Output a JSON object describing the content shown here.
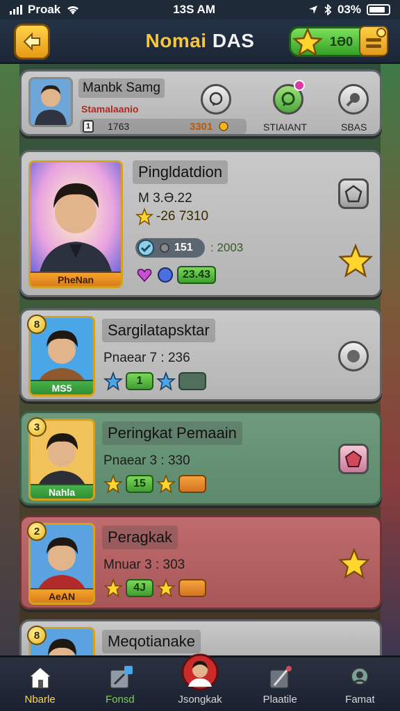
{
  "status_bar": {
    "carrier": "Proak",
    "time": "13S AM",
    "battery": "03%"
  },
  "header": {
    "title_part1": "Nomai",
    "title_part2": "DAS",
    "coins": "1Ə0"
  },
  "profile": {
    "name": "Manbk Samg",
    "subtitle": "Stamalaanio",
    "level_badge": "1",
    "score": "1763",
    "coins": "3301",
    "actions": [
      {
        "label": ""
      },
      {
        "label": "STIAIANT"
      },
      {
        "label": "SBAS"
      }
    ]
  },
  "featured": {
    "name": "Pingldatdion",
    "portrait_label": "PheNan",
    "line1": "M 3.Ə.22",
    "line2": "-26 7310",
    "stat_a": "151",
    "stat_b": ": 2003",
    "stat_c": "23.43"
  },
  "players": [
    {
      "rank": "8",
      "name": "Sargilatapsktar",
      "portrait_label": "MS5",
      "stat": "Pnaear 7 : 236",
      "bar_value": "1",
      "bar_color": "green",
      "theme": "grey"
    },
    {
      "rank": "3",
      "name": "Peringkat Pemaain",
      "portrait_label": "Nahla",
      "stat": "Pnaear 3 : 330",
      "bar_value": "15",
      "bar_color": "green",
      "theme": "green"
    },
    {
      "rank": "2",
      "name": "Peragkak",
      "portrait_label": "AeAN",
      "stat": "Mnuar 3 : 303",
      "bar_value": "4J",
      "bar_color": "green",
      "theme": "red"
    },
    {
      "rank": "8",
      "name": "Meqotianake",
      "portrait_label": "",
      "stat": "",
      "bar_value": "",
      "bar_color": "green",
      "theme": "grey"
    }
  ],
  "bottom_nav": [
    {
      "label": "Nbarle",
      "icon": "home-icon"
    },
    {
      "label": "Fonsd",
      "icon": "edit-icon"
    },
    {
      "label": "Jsongkak",
      "icon": "avatar-icon"
    },
    {
      "label": "Plaatile",
      "icon": "pencil-icon"
    },
    {
      "label": "Famat",
      "icon": "search-icon"
    }
  ],
  "colors": {
    "accent": "#f8c63a",
    "green": "#3e9e2f",
    "orange": "#d57322",
    "panel": "#c4c4c4"
  }
}
